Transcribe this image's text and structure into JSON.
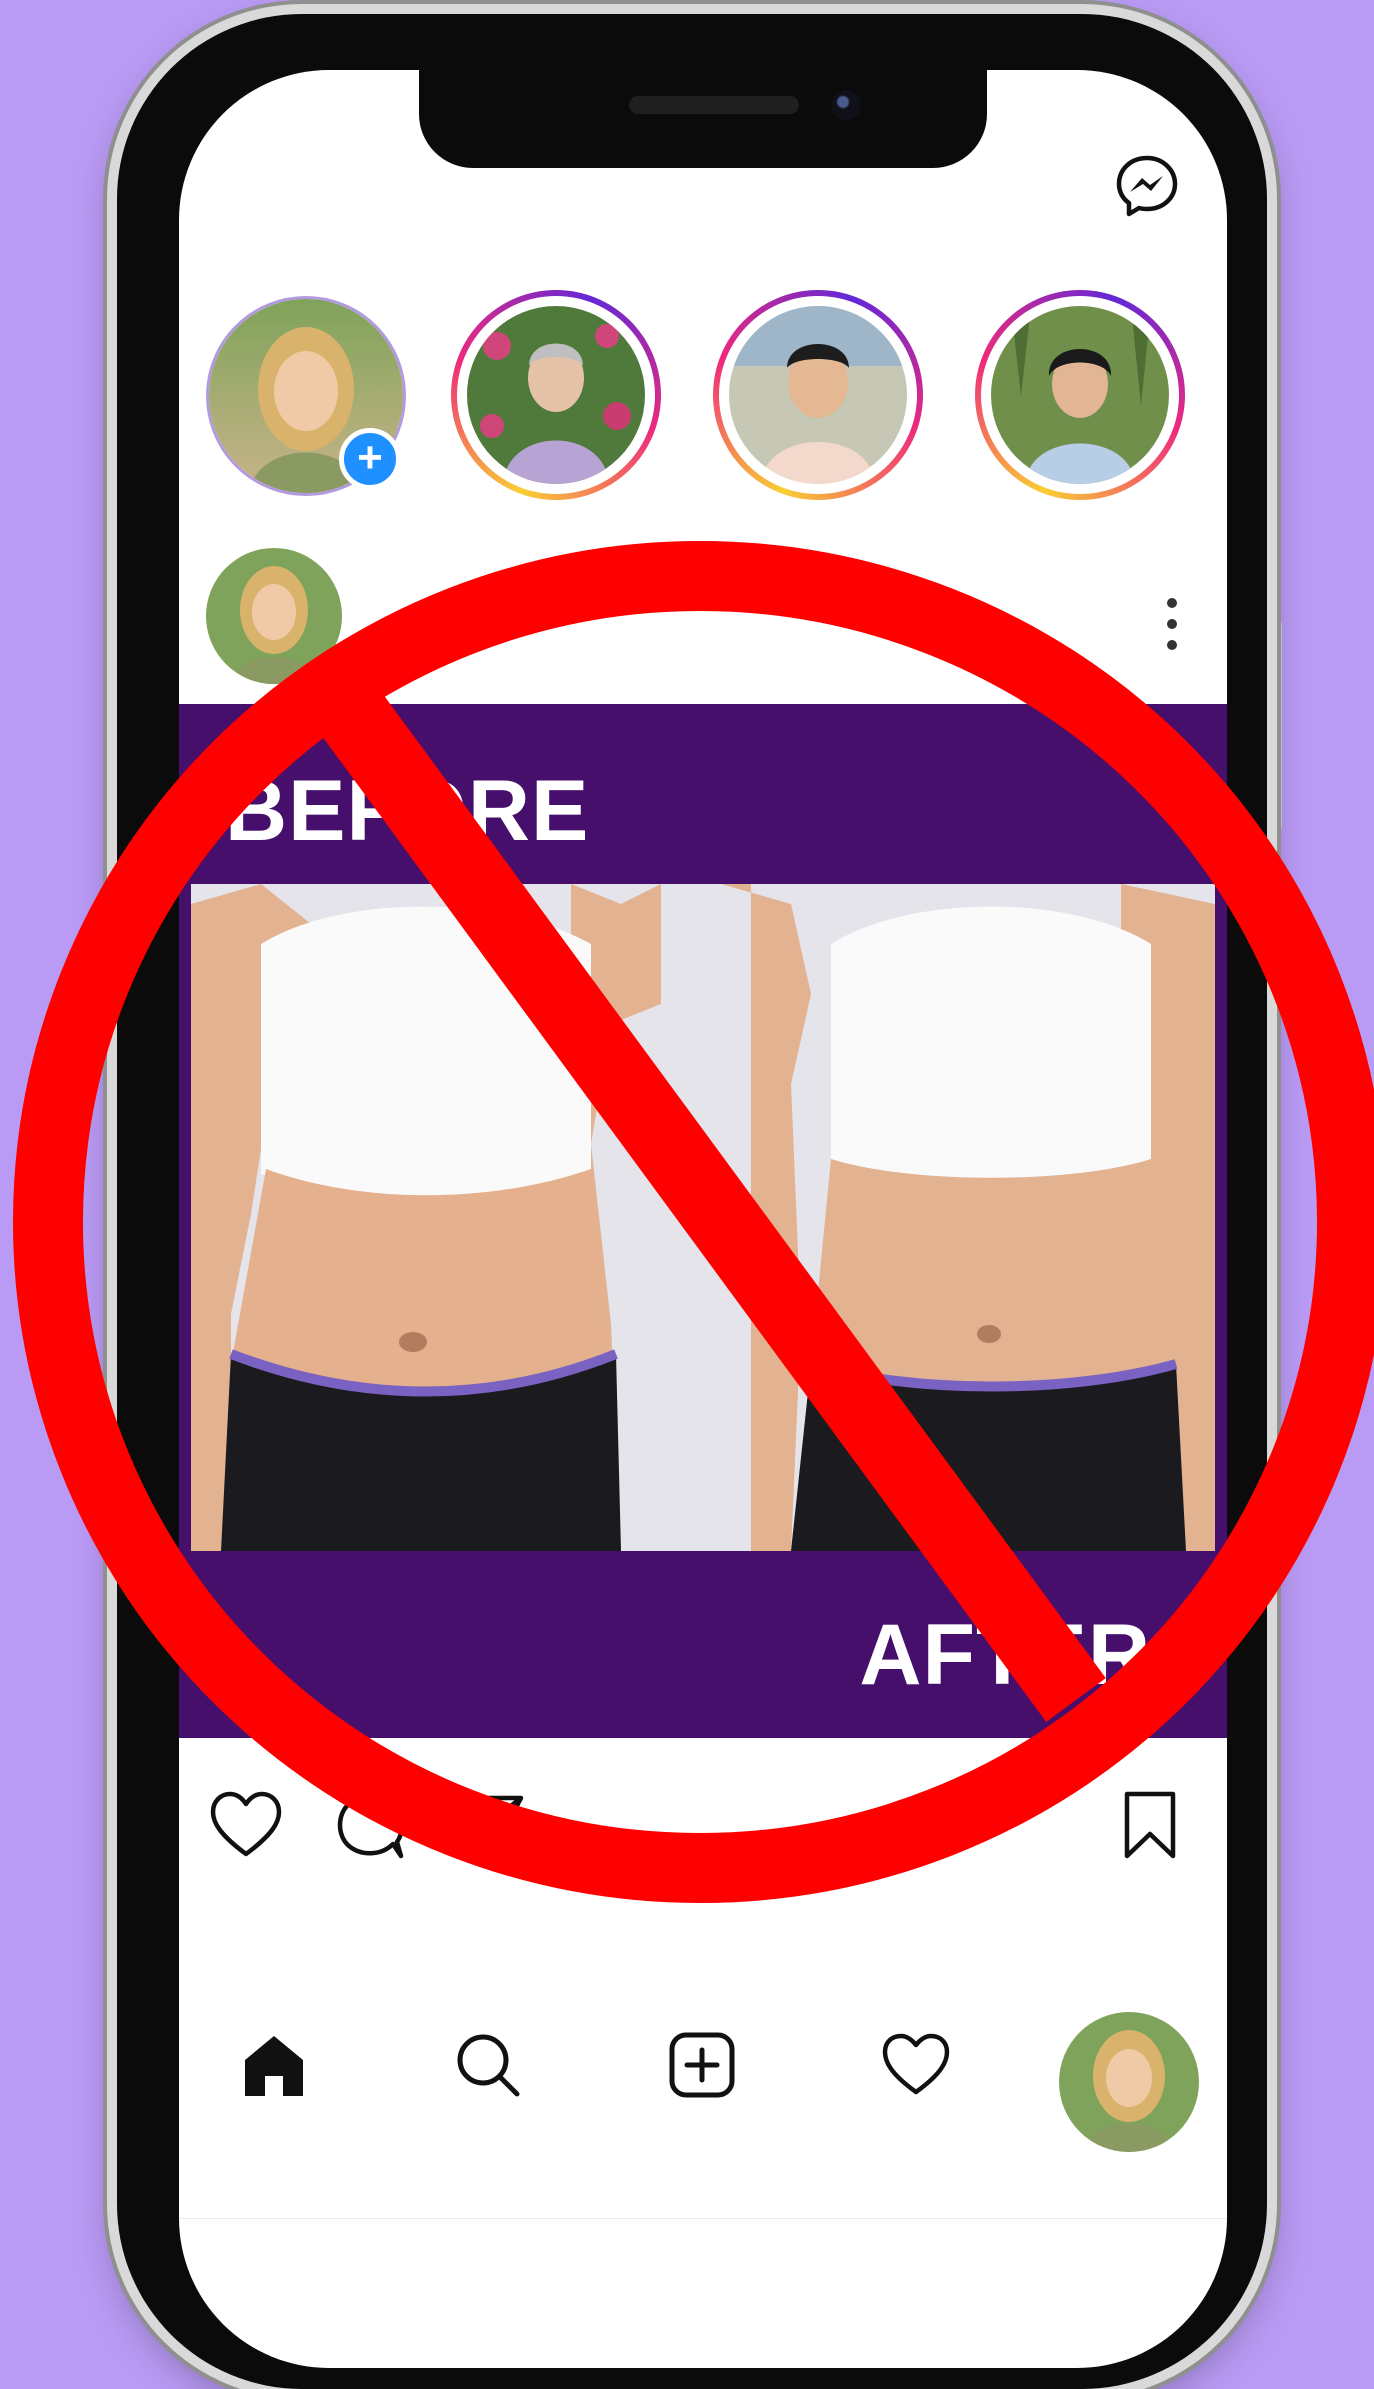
{
  "post": {
    "before_label": "BEFORE",
    "after_label": "AFTER"
  },
  "colors": {
    "background": "#B99AF4",
    "post_background": "#470F6C",
    "prohibition_sign": "#FF0000",
    "story_badge": "#1E90FF"
  },
  "icons": {
    "top": [
      "messenger-icon"
    ],
    "stories": [
      "add-story-icon"
    ],
    "post": [
      "more-options-icon"
    ],
    "actions": [
      "heart-icon",
      "comment-icon",
      "share-icon",
      "bookmark-icon"
    ],
    "nav": [
      "home-icon",
      "search-icon",
      "new-post-icon",
      "activity-heart-icon",
      "profile-avatar"
    ]
  },
  "overlay": "prohibition-sign"
}
